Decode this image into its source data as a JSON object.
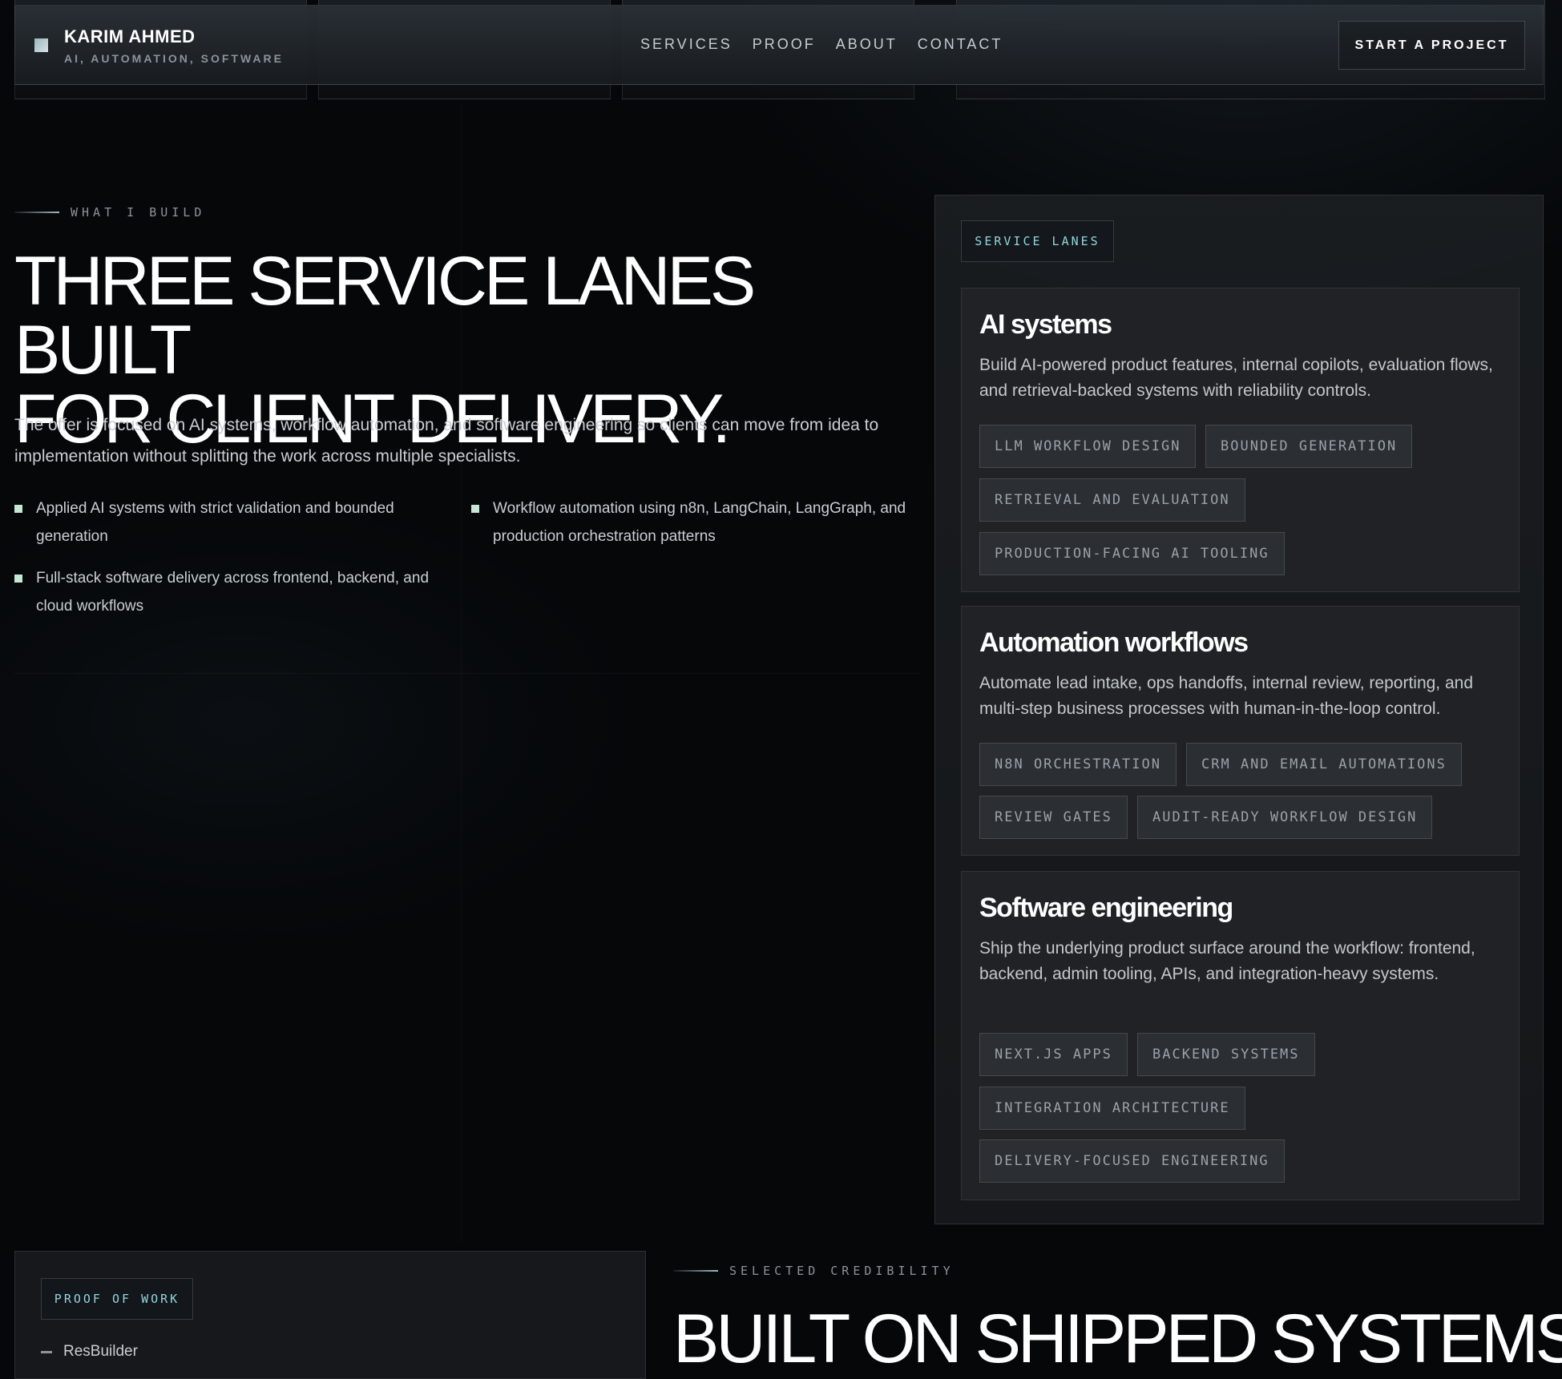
{
  "header": {
    "brand_name": "KARIM AHMED",
    "brand_tagline": "AI, AUTOMATION, SOFTWARE",
    "nav": [
      "SERVICES",
      "PROOF",
      "ABOUT",
      "CONTACT"
    ],
    "cta_label": "START A PROJECT"
  },
  "hero": {
    "eyebrow": "WHAT I BUILD",
    "title_line1": "THREE SERVICE LANES BUILT",
    "title_line2": "FOR CLIENT DELIVERY.",
    "lead": "The offer is focused on AI systems, workflow automation, and software engineering so clients can move from idea to implementation without splitting the work across multiple specialists.",
    "bullets": [
      "Applied AI systems with strict validation and bounded generation",
      "Workflow automation using n8n, LangChain, LangGraph, and production orchestration patterns",
      "Full-stack software delivery across frontend, backend, and cloud workflows"
    ]
  },
  "service_panel": {
    "label": "SERVICE LANES",
    "lanes": [
      {
        "title": "AI systems",
        "description": "Build AI-powered product features, internal copilots, evaluation flows, and retrieval-backed systems with reliability controls.",
        "tags": [
          "LLM WORKFLOW DESIGN",
          "BOUNDED GENERATION",
          "RETRIEVAL AND EVALUATION",
          "PRODUCTION-FACING AI TOOLING"
        ]
      },
      {
        "title": "Automation workflows",
        "description": "Automate lead intake, ops handoffs, internal review, reporting, and multi-step business processes with human-in-the-loop control.",
        "tags": [
          "N8N ORCHESTRATION",
          "CRM AND EMAIL AUTOMATIONS",
          "REVIEW GATES",
          "AUDIT-READY WORKFLOW DESIGN"
        ]
      },
      {
        "title": "Software engineering",
        "description": "Ship the underlying product surface around the workflow: frontend, backend, admin tooling, APIs, and integration-heavy systems.",
        "tags": [
          "NEXT.JS APPS",
          "BACKEND SYSTEMS",
          "INTEGRATION ARCHITECTURE",
          "DELIVERY-FOCUSED ENGINEERING"
        ]
      }
    ]
  },
  "proof": {
    "label": "PROOF OF WORK",
    "first_item": "ResBuilder"
  },
  "credibility": {
    "eyebrow": "SELECTED CREDIBILITY",
    "title": "BUILT ON SHIPPED SYSTEMS"
  }
}
